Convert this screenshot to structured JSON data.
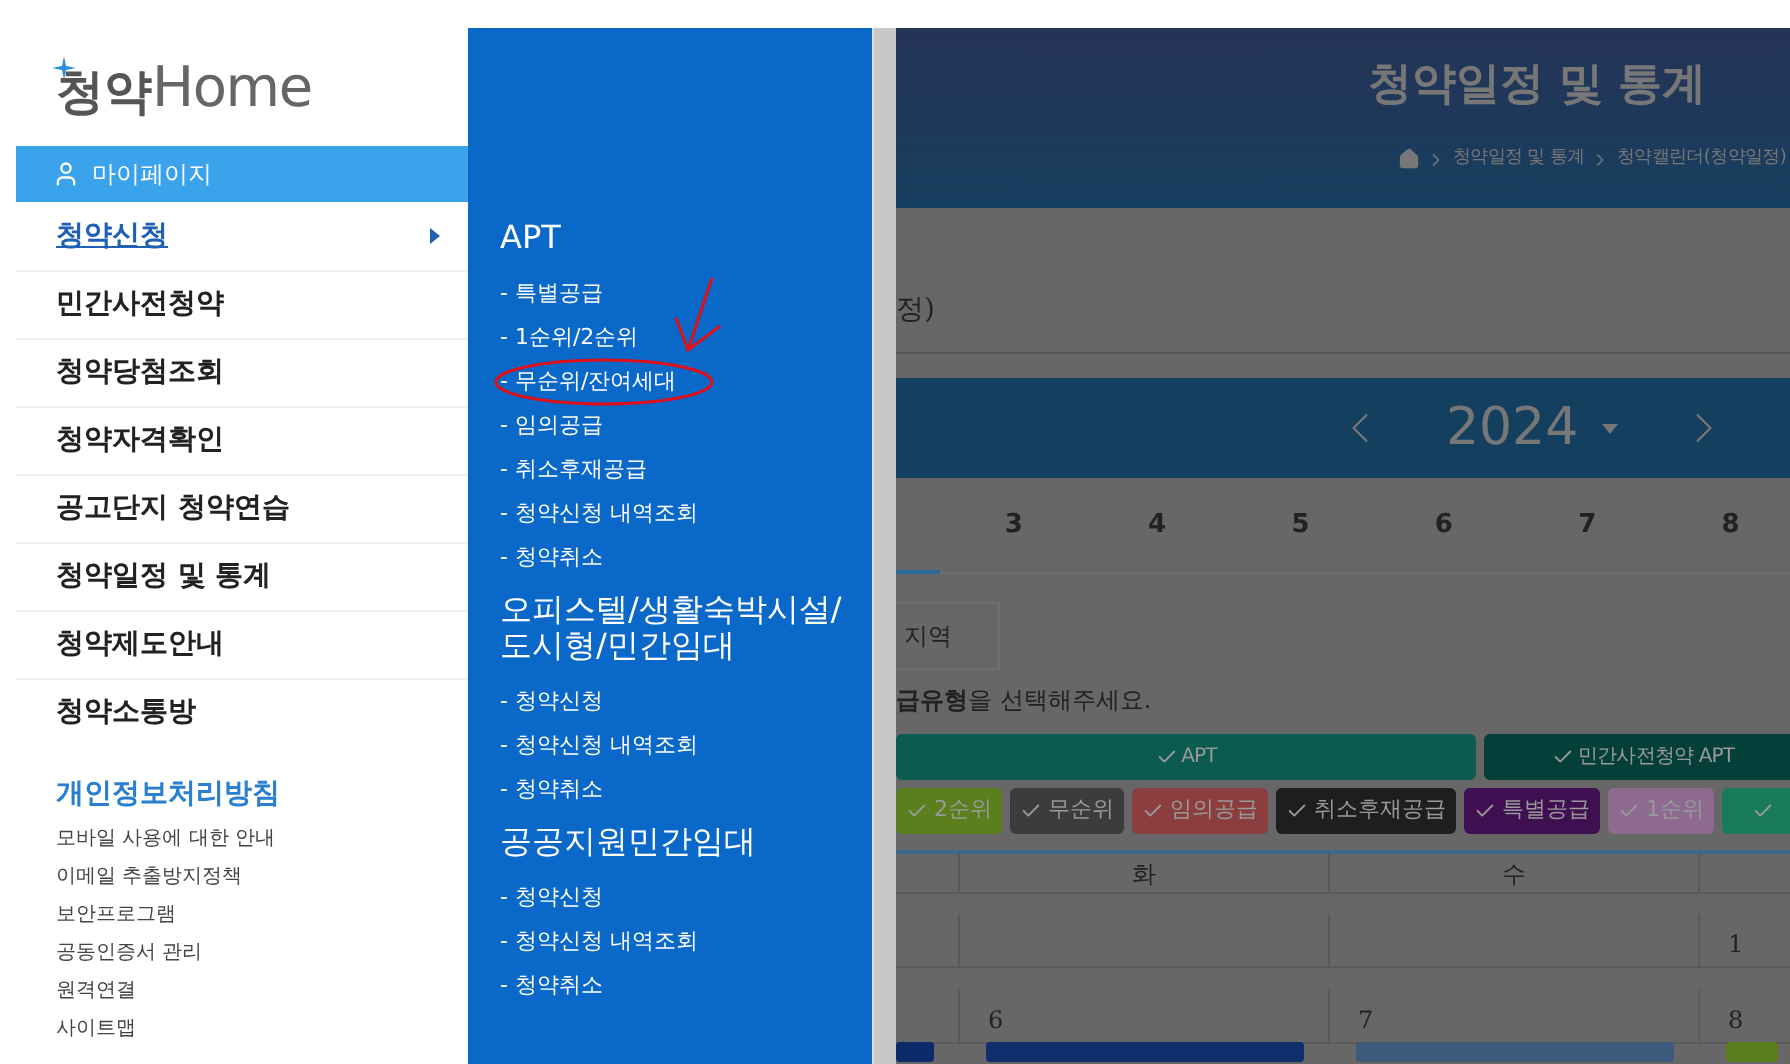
{
  "logo": {
    "text_ko": "청약",
    "text_en": "Home"
  },
  "sidebar": {
    "mypage": "마이페이지",
    "items": [
      {
        "label": "청약신청",
        "selected": true
      },
      {
        "label": "민간사전청약",
        "selected": false
      },
      {
        "label": "청약당첨조회",
        "selected": false
      },
      {
        "label": "청약자격확인",
        "selected": false
      },
      {
        "label": "공고단지 청약연습",
        "selected": false
      },
      {
        "label": "청약일정 및 통계",
        "selected": false
      },
      {
        "label": "청약제도안내",
        "selected": false
      },
      {
        "label": "청약소통방",
        "selected": false
      }
    ],
    "policy": "개인정보처리방침",
    "links": [
      "모바일 사용에 대한 안내",
      "이메일 추출방지정책",
      "보안프로그램",
      "공동인증서 관리",
      "원격연결",
      "사이트맵"
    ]
  },
  "submenu": {
    "sections": [
      {
        "title": "APT",
        "items": [
          {
            "label": "- 특별공급",
            "annotated": false
          },
          {
            "label": "- 1순위/2순위",
            "annotated": false
          },
          {
            "label": "- 무순위/잔여세대",
            "annotated": true
          },
          {
            "label": "- 임의공급",
            "annotated": false
          },
          {
            "label": "- 취소후재공급",
            "annotated": false
          },
          {
            "label": "- 청약신청 내역조회",
            "annotated": false
          },
          {
            "label": "- 청약취소",
            "annotated": false
          }
        ]
      },
      {
        "title": "오피스텔/생활숙박시설/도시형/민간임대",
        "items": [
          {
            "label": "- 청약신청",
            "annotated": false
          },
          {
            "label": "- 청약신청 내역조회",
            "annotated": false
          },
          {
            "label": "- 청약취소",
            "annotated": false
          }
        ]
      },
      {
        "title": "공공지원민간임대",
        "items": [
          {
            "label": "- 청약신청",
            "annotated": false
          },
          {
            "label": "- 청약신청 내역조회",
            "annotated": false
          },
          {
            "label": "- 청약취소",
            "annotated": false
          }
        ]
      }
    ]
  },
  "page": {
    "title": "청약일정 및 통계",
    "breadcrumb": [
      "청약일정 및 통계",
      "청약캘린더(청약일정)"
    ],
    "subtitle": "정)",
    "year": "2024",
    "months": [
      "3",
      "4",
      "5",
      "6",
      "7",
      "8"
    ],
    "region_tab": "지역",
    "instruction": "**급유형**을 선택해주세요.",
    "filter_groups": [
      {
        "label": "APT",
        "color": "#0c5b50"
      },
      {
        "label": "민간사전청약 APT",
        "color": "#053f3a"
      }
    ],
    "filters": [
      {
        "label": "2순위",
        "color": "#5a7f1c"
      },
      {
        "label": "무순위",
        "color": "#3c3c3c"
      },
      {
        "label": "임의공급",
        "color": "#8c3e3e"
      },
      {
        "label": "취소후재공급",
        "color": "#1e1e1e"
      },
      {
        "label": "특별공급",
        "color": "#3f0f52"
      },
      {
        "label": "1순위",
        "color": "#8e6a91"
      },
      {
        "color": "#1a7a5c"
      }
    ],
    "calendar": {
      "weekdays": [
        "화",
        "수"
      ],
      "rows": [
        [
          "",
          "",
          "1"
        ],
        [
          "6",
          "7",
          "8"
        ]
      ],
      "events": [
        {
          "color": "#0c2a6a"
        },
        {
          "color": "#0e2f6b"
        },
        {
          "color": "#3c5a7c"
        },
        {
          "color": "#5a7f1c"
        }
      ]
    }
  }
}
